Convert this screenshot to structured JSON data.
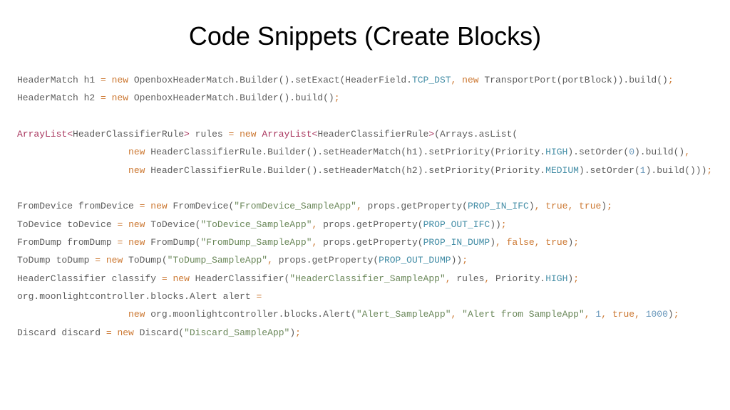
{
  "title": "Code Snippets (Create Blocks)",
  "tokens": [
    [
      [
        "id",
        "HeaderMatch h1 "
      ],
      [
        "op",
        "="
      ],
      [
        "id",
        " "
      ],
      [
        "kw",
        "new"
      ],
      [
        "id",
        " OpenboxHeaderMatch.Builder().setExact(HeaderField."
      ],
      [
        "fld",
        "TCP_DST"
      ],
      [
        "op",
        ","
      ],
      [
        "id",
        " "
      ],
      [
        "kw",
        "new"
      ],
      [
        "id",
        " TransportPort(portBlock)).build()"
      ],
      [
        "op",
        ";"
      ]
    ],
    [
      [
        "id",
        "HeaderMatch h2 "
      ],
      [
        "op",
        "="
      ],
      [
        "id",
        " "
      ],
      [
        "kw",
        "new"
      ],
      [
        "id",
        " OpenboxHeaderMatch.Builder().build()"
      ],
      [
        "op",
        ";"
      ]
    ],
    [],
    [
      [
        "typ",
        "ArrayList<"
      ],
      [
        "id",
        "HeaderClassifierRule"
      ],
      [
        "typ",
        ">"
      ],
      [
        "id",
        " rules "
      ],
      [
        "op",
        "="
      ],
      [
        "id",
        " "
      ],
      [
        "kw",
        "new"
      ],
      [
        "id",
        " "
      ],
      [
        "typ",
        "ArrayList<"
      ],
      [
        "id",
        "HeaderClassifierRule"
      ],
      [
        "typ",
        ">"
      ],
      [
        "id",
        "(Arrays.asList("
      ]
    ],
    [
      [
        "id",
        "                    "
      ],
      [
        "kw",
        "new"
      ],
      [
        "id",
        " HeaderClassifierRule.Builder().setHeaderMatch(h1).setPriority(Priority."
      ],
      [
        "fld",
        "HIGH"
      ],
      [
        "id",
        ").setOrder("
      ],
      [
        "num",
        "0"
      ],
      [
        "id",
        ").build()"
      ],
      [
        "op",
        ","
      ]
    ],
    [
      [
        "id",
        "                    "
      ],
      [
        "kw",
        "new"
      ],
      [
        "id",
        " HeaderClassifierRule.Builder().setHeaderMatch(h2).setPriority(Priority."
      ],
      [
        "fld",
        "MEDIUM"
      ],
      [
        "id",
        ").setOrder("
      ],
      [
        "num",
        "1"
      ],
      [
        "id",
        ").build()))"
      ],
      [
        "op",
        ";"
      ]
    ],
    [],
    [
      [
        "id",
        "FromDevice fromDevice "
      ],
      [
        "op",
        "="
      ],
      [
        "id",
        " "
      ],
      [
        "kw",
        "new"
      ],
      [
        "id",
        " FromDevice("
      ],
      [
        "str",
        "\"FromDevice_SampleApp\""
      ],
      [
        "op",
        ","
      ],
      [
        "id",
        " props.getProperty("
      ],
      [
        "fld",
        "PROP_IN_IFC"
      ],
      [
        "id",
        ")"
      ],
      [
        "op",
        ","
      ],
      [
        "id",
        " "
      ],
      [
        "kw",
        "true"
      ],
      [
        "op",
        ","
      ],
      [
        "id",
        " "
      ],
      [
        "kw",
        "true"
      ],
      [
        "id",
        ")"
      ],
      [
        "op",
        ";"
      ]
    ],
    [
      [
        "id",
        "ToDevice toDevice "
      ],
      [
        "op",
        "="
      ],
      [
        "id",
        " "
      ],
      [
        "kw",
        "new"
      ],
      [
        "id",
        " ToDevice("
      ],
      [
        "str",
        "\"ToDevice_SampleApp\""
      ],
      [
        "op",
        ","
      ],
      [
        "id",
        " props.getProperty("
      ],
      [
        "fld",
        "PROP_OUT_IFC"
      ],
      [
        "id",
        "))"
      ],
      [
        "op",
        ";"
      ]
    ],
    [
      [
        "id",
        "FromDump fromDump "
      ],
      [
        "op",
        "="
      ],
      [
        "id",
        " "
      ],
      [
        "kw",
        "new"
      ],
      [
        "id",
        " FromDump("
      ],
      [
        "str",
        "\"FromDump_SampleApp\""
      ],
      [
        "op",
        ","
      ],
      [
        "id",
        " props.getProperty("
      ],
      [
        "fld",
        "PROP_IN_DUMP"
      ],
      [
        "id",
        ")"
      ],
      [
        "op",
        ","
      ],
      [
        "id",
        " "
      ],
      [
        "kw",
        "false"
      ],
      [
        "op",
        ","
      ],
      [
        "id",
        " "
      ],
      [
        "kw",
        "true"
      ],
      [
        "id",
        ")"
      ],
      [
        "op",
        ";"
      ]
    ],
    [
      [
        "id",
        "ToDump toDump "
      ],
      [
        "op",
        "="
      ],
      [
        "id",
        " "
      ],
      [
        "kw",
        "new"
      ],
      [
        "id",
        " ToDump("
      ],
      [
        "str",
        "\"ToDump_SampleApp\""
      ],
      [
        "op",
        ","
      ],
      [
        "id",
        " props.getProperty("
      ],
      [
        "fld",
        "PROP_OUT_DUMP"
      ],
      [
        "id",
        "))"
      ],
      [
        "op",
        ";"
      ]
    ],
    [
      [
        "id",
        "HeaderClassifier classify "
      ],
      [
        "op",
        "="
      ],
      [
        "id",
        " "
      ],
      [
        "kw",
        "new"
      ],
      [
        "id",
        " HeaderClassifier("
      ],
      [
        "str",
        "\"HeaderClassifier_SampleApp\""
      ],
      [
        "op",
        ","
      ],
      [
        "id",
        " rules"
      ],
      [
        "op",
        ","
      ],
      [
        "id",
        " Priority."
      ],
      [
        "fld",
        "HIGH"
      ],
      [
        "id",
        ")"
      ],
      [
        "op",
        ";"
      ]
    ],
    [
      [
        "id",
        "org.moonlightcontroller.blocks.Alert alert "
      ],
      [
        "op",
        "="
      ]
    ],
    [
      [
        "id",
        "                    "
      ],
      [
        "kw",
        "new"
      ],
      [
        "id",
        " org.moonlightcontroller.blocks.Alert("
      ],
      [
        "str",
        "\"Alert_SampleApp\""
      ],
      [
        "op",
        ","
      ],
      [
        "id",
        " "
      ],
      [
        "str",
        "\"Alert from SampleApp\""
      ],
      [
        "op",
        ","
      ],
      [
        "id",
        " "
      ],
      [
        "num",
        "1"
      ],
      [
        "op",
        ","
      ],
      [
        "id",
        " "
      ],
      [
        "kw",
        "true"
      ],
      [
        "op",
        ","
      ],
      [
        "id",
        " "
      ],
      [
        "num",
        "1000"
      ],
      [
        "id",
        ")"
      ],
      [
        "op",
        ";"
      ]
    ],
    [
      [
        "id",
        "Discard discard "
      ],
      [
        "op",
        "="
      ],
      [
        "id",
        " "
      ],
      [
        "kw",
        "new"
      ],
      [
        "id",
        " Discard("
      ],
      [
        "str",
        "\"Discard_SampleApp\""
      ],
      [
        "id",
        ")"
      ],
      [
        "op",
        ";"
      ]
    ]
  ]
}
